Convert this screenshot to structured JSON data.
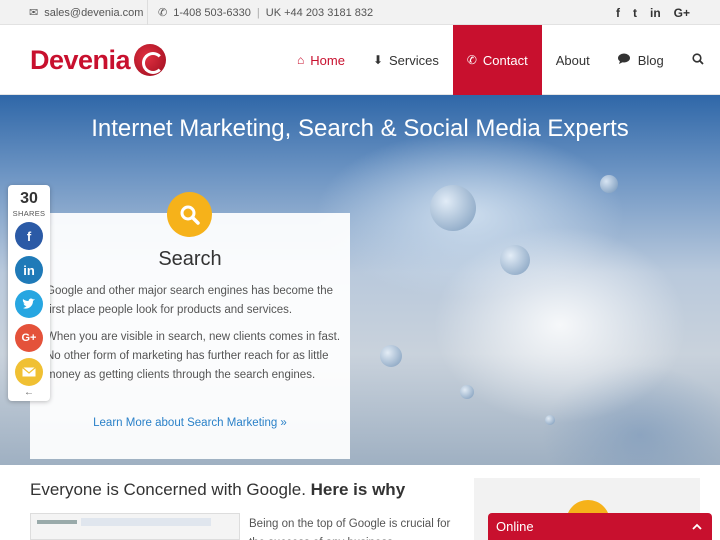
{
  "topbar": {
    "email_icon": "envelope-icon",
    "email": "sales@devenia.com",
    "phone_icon": "phone-icon",
    "phone_us": "1-408 503-6330",
    "separator": "|",
    "phone_uk": "UK +44 203 3181 832",
    "social": [
      {
        "name": "facebook-icon",
        "glyph": "f"
      },
      {
        "name": "twitter-icon",
        "glyph": "t"
      },
      {
        "name": "linkedin-icon",
        "glyph": "in"
      },
      {
        "name": "google-plus-icon",
        "glyph": "G+"
      }
    ]
  },
  "header": {
    "logo_text": "Devenia",
    "nav": [
      {
        "label": "Home",
        "icon": "home-icon",
        "glyph": "⌂"
      },
      {
        "label": "Services",
        "icon": "arrow-down-icon",
        "glyph": "⬇"
      },
      {
        "label": "Contact",
        "icon": "phone-icon",
        "glyph": "✆"
      },
      {
        "label": "About",
        "icon": "",
        "glyph": ""
      },
      {
        "label": "Blog",
        "icon": "comments-icon",
        "glyph": "💬"
      }
    ],
    "search_icon": "search-icon"
  },
  "hero": {
    "title": "Internet Marketing, Search & Social Media Experts",
    "card": {
      "icon": "search-icon",
      "title": "Search",
      "paragraph_1": "Google and other major search engines has become the first place people look for products and services.",
      "paragraph_2": "When you are visible in search, new clients comes in fast. No other form of marketing has further reach for as little money as getting clients through the search engines.",
      "link": "Learn More about Search Marketing »"
    }
  },
  "share_bar": {
    "count": "30",
    "label": "SHARES",
    "buttons": [
      "facebook-share-icon",
      "linkedin-share-icon",
      "twitter-share-icon",
      "google-plus-share-icon",
      "email-share-icon"
    ],
    "collapse_glyph": "←"
  },
  "lower": {
    "heading_plain": "Everyone is Concerned with Google. ",
    "heading_bold": "Here is why",
    "text": "Being on the top of Google is crucial for the success of any business."
  },
  "chat": {
    "label": "Online",
    "chevron": "^"
  },
  "colors": {
    "brand_red": "#c8102e",
    "accent_yellow": "#f6b21a",
    "link_blue": "#2a80c8"
  }
}
